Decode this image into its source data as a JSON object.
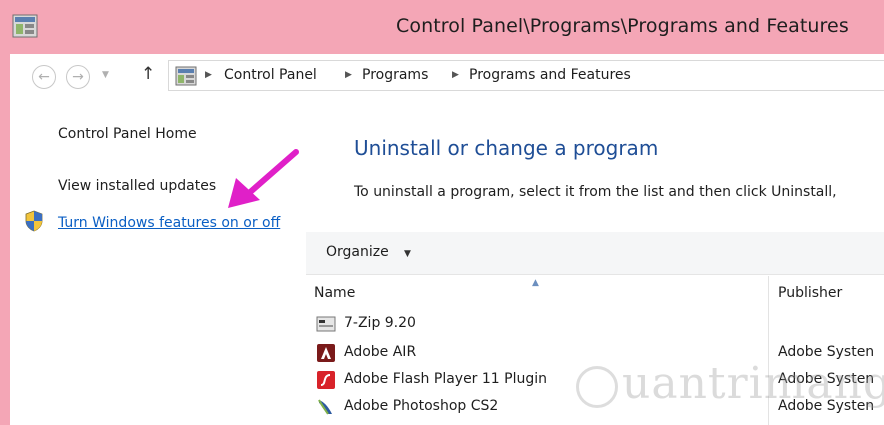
{
  "window": {
    "title": "Control Panel\\Programs\\Programs and Features"
  },
  "nav": {
    "breadcrumbs": [
      "Control Panel",
      "Programs",
      "Programs and Features"
    ]
  },
  "sidebar": {
    "home_label": "Control Panel Home",
    "updates_label": "View installed updates",
    "features_label": "Turn Windows features on or off"
  },
  "main": {
    "heading": "Uninstall or change a program",
    "description": "To uninstall a program, select it from the list and then click Uninstall,"
  },
  "toolbar": {
    "organize_label": "Organize"
  },
  "table": {
    "columns": [
      "Name",
      "Publisher"
    ],
    "rows": [
      {
        "name": "7-Zip 9.20",
        "publisher": "",
        "icon": "7zip-icon"
      },
      {
        "name": "Adobe AIR",
        "publisher": "Adobe Systen",
        "icon": "adobe-air-icon"
      },
      {
        "name": "Adobe Flash Player 11 Plugin",
        "publisher": "Adobe Systen",
        "icon": "adobe-flash-icon"
      },
      {
        "name": "Adobe Photoshop CS2",
        "publisher": "Adobe Systen",
        "icon": "adobe-photoshop-icon"
      }
    ]
  },
  "watermark": {
    "text": "uantrimang"
  },
  "colors": {
    "titlebar": "#f4a6b6",
    "heading": "#1f4e96",
    "link": "#0b5fc4",
    "arrow": "#e020c8"
  }
}
